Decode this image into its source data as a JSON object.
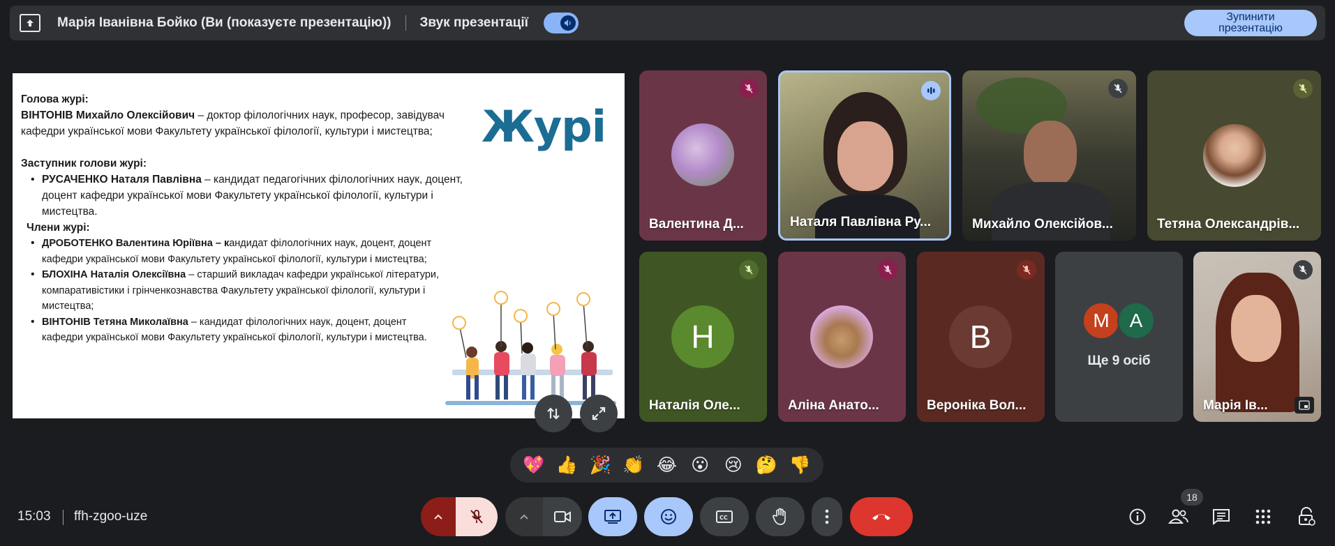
{
  "topbar": {
    "presenter": "Марія Іванівна Бойко (Ви (показуєте презентацію))",
    "sound_label": "Звук презентації",
    "stop_button": "Зупинити презентацію"
  },
  "slide": {
    "title": "Журі",
    "head_label": "Голова журі:",
    "head_name": "ВІНТОНІВ Михайло Олексійович",
    "head_desc": " – доктор філологічних наук, професор, завідувач кафедри української мови Факультету української філології, культури і мистецтва;",
    "deputy_label": "Заступник голови журі:",
    "deputy_name": "РУСАЧЕНКО Наталя Павлівна",
    "deputy_desc": " – кандидат педагогічних філологічних наук, доцент, доцент кафедри української мови Факультету української філології, культури і мистецтва.",
    "members_label": "Члени журі:",
    "members": [
      {
        "name": " ДРОБОТЕНКО Валентина Юріївна – к",
        "desc": "андидат філологічних наук, доцент, доцент кафедри української мови Факультету української філології, культури і мистецтва;"
      },
      {
        "name": "БЛОХІНА Наталія Олексіївна",
        "desc": " – старший викладач кафедри української літератури, компаративістики і грінченкознавства Факультету української філології, культури і мистецтва;"
      },
      {
        "name": "ВІНТОНІВ Тетяна Миколаївна",
        "desc": " – кандидат філологічних наук, доцент, доцент кафедри української мови Факультету української філології, культури і мистецтва."
      }
    ]
  },
  "participants": [
    {
      "name": "Валентина Д...",
      "status": "muted"
    },
    {
      "name": "Наталя Павлівна Ру...",
      "status": "speaking"
    },
    {
      "name": "Михайло Олексійов...",
      "status": "muted"
    },
    {
      "name": "Тетяна Олександрів...",
      "status": "muted"
    },
    {
      "name": "Наталія Оле...",
      "initial": "Н",
      "status": "muted"
    },
    {
      "name": "Аліна Анато...",
      "status": "muted"
    },
    {
      "name": "Вероніка Вол...",
      "initial": "В",
      "status": "muted"
    },
    {
      "name": "Ще 9 осіб",
      "initials": [
        "М",
        "А"
      ]
    },
    {
      "name": "Марія Ів...",
      "status": "muted"
    }
  ],
  "reactions": [
    "💖",
    "👍",
    "🎉",
    "👏",
    "😂",
    "😮",
    "😢",
    "🤔",
    "👎"
  ],
  "bottombar": {
    "time": "15:03",
    "meeting_code": "ffh-zgoo-uze",
    "participants_count": "18"
  },
  "colors": {
    "accent": "#8ab4f8",
    "end_call": "#dc362e",
    "mic_off_bg": "#f9dedc",
    "active_btn": "#a8c7fa"
  },
  "icons": [
    "present-to-all-icon",
    "volume-icon",
    "mic-off-icon",
    "audio-wave-icon",
    "swap-icon",
    "fullscreen-icon",
    "chevron-up-icon",
    "camera-icon",
    "present-icon",
    "emoji-icon",
    "captions-icon",
    "hand-icon",
    "more-vert-icon",
    "end-call-icon",
    "info-icon",
    "people-icon",
    "chat-icon",
    "apps-icon",
    "host-controls-icon"
  ]
}
